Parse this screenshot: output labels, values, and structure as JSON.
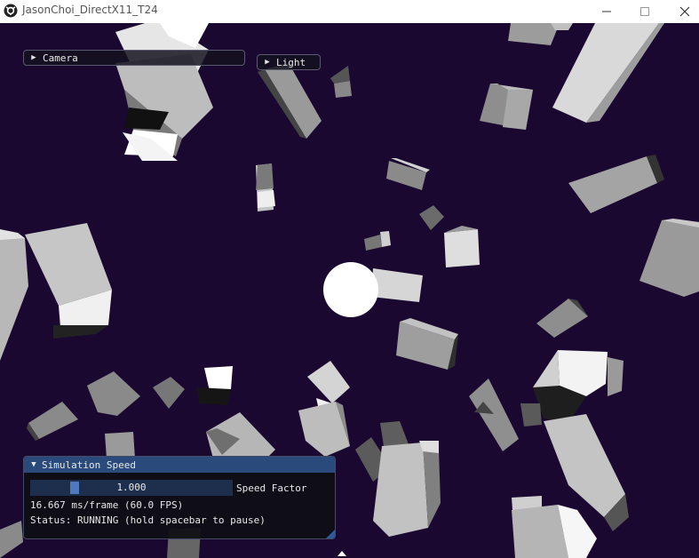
{
  "window": {
    "title": "JasonChoi_DirectX11_T24",
    "minimize_icon": "minimize-icon",
    "maximize_icon": "maximize-icon",
    "close_icon": "close-icon"
  },
  "scene": {
    "background_color": "#1b0831",
    "light_sphere_color": "#ffffff"
  },
  "camera_header": {
    "label": "Camera",
    "icon": "collapsed-arrow-icon"
  },
  "light_header": {
    "label": "Light",
    "icon": "collapsed-arrow-icon"
  },
  "simulation_panel": {
    "title": "Simulation Speed",
    "title_icon": "expanded-arrow-icon",
    "speed_factor": {
      "value": "1.000",
      "label": "Speed Factor",
      "min": 0,
      "max": 5
    },
    "frame_stats": "16.667 ms/frame (60.0 FPS)",
    "status": "Status: RUNNING (hold spacebar to pause)"
  }
}
